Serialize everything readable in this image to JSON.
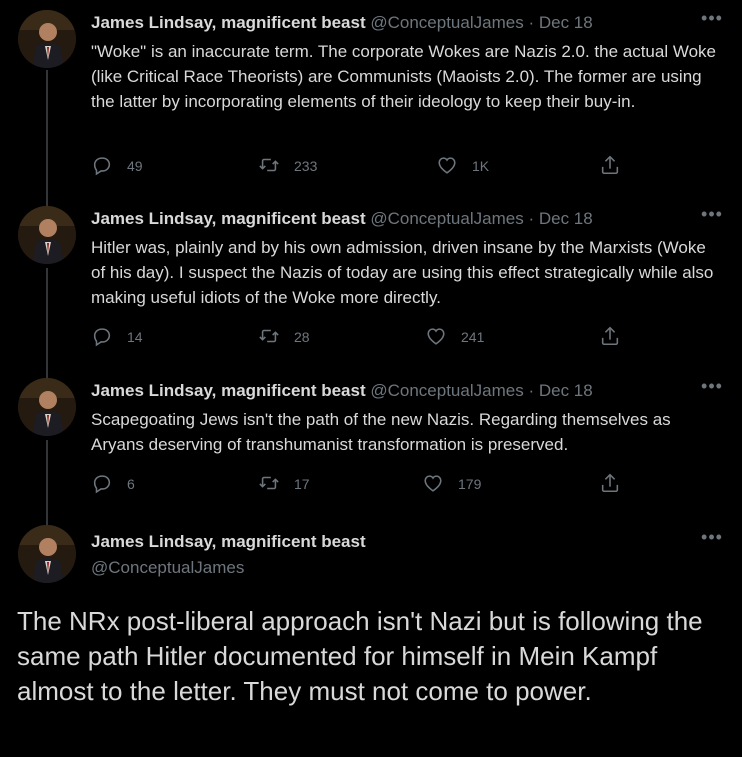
{
  "tweets": [
    {
      "name": "James Lindsay, magnificent beast",
      "handle": "@ConceptualJames",
      "separator": "·",
      "date": "Dec 18",
      "text": "\"Woke\" is an inaccurate term. The corporate Wokes are Nazis 2.0. the actual Woke (like Critical Race Theorists) are Communists (Maoists 2.0). The former are using the latter by incorporating elements of their ideology to keep their buy-in.",
      "replies": "49",
      "retweets": "233",
      "likes": "1K"
    },
    {
      "name": "James Lindsay, magnificent beast",
      "handle": "@ConceptualJames",
      "separator": "·",
      "date": "Dec 18",
      "text": "Hitler was, plainly and by his own admission, driven insane by the Marxists (Woke of his day). I suspect the Nazis of today are using this effect strategically while also making useful idiots of the Woke more directly.",
      "replies": "14",
      "retweets": "28",
      "likes": "241"
    },
    {
      "name": "James Lindsay, magnificent beast",
      "handle": "@ConceptualJames",
      "separator": "·",
      "date": "Dec 18",
      "text": "Scapegoating Jews isn't the path of the new Nazis. Regarding themselves as Aryans deserving of transhumanist transformation is preserved.",
      "replies": "6",
      "retweets": "17",
      "likes": "179"
    }
  ],
  "main_tweet": {
    "name": "James Lindsay, magnificent beast",
    "handle": "@ConceptualJames",
    "text": "The NRx post-liberal approach isn't Nazi but is following the same path Hitler documented for himself in Mein Kampf almost to the letter. They must not come to power."
  },
  "more_glyph": "•••",
  "icons": [
    "reply-icon",
    "retweet-icon",
    "like-icon",
    "share-icon",
    "more-icon"
  ],
  "colors": {
    "background": "#000000",
    "text": "#d9d9d9",
    "muted": "#6e767d",
    "thread_line": "#333639"
  }
}
